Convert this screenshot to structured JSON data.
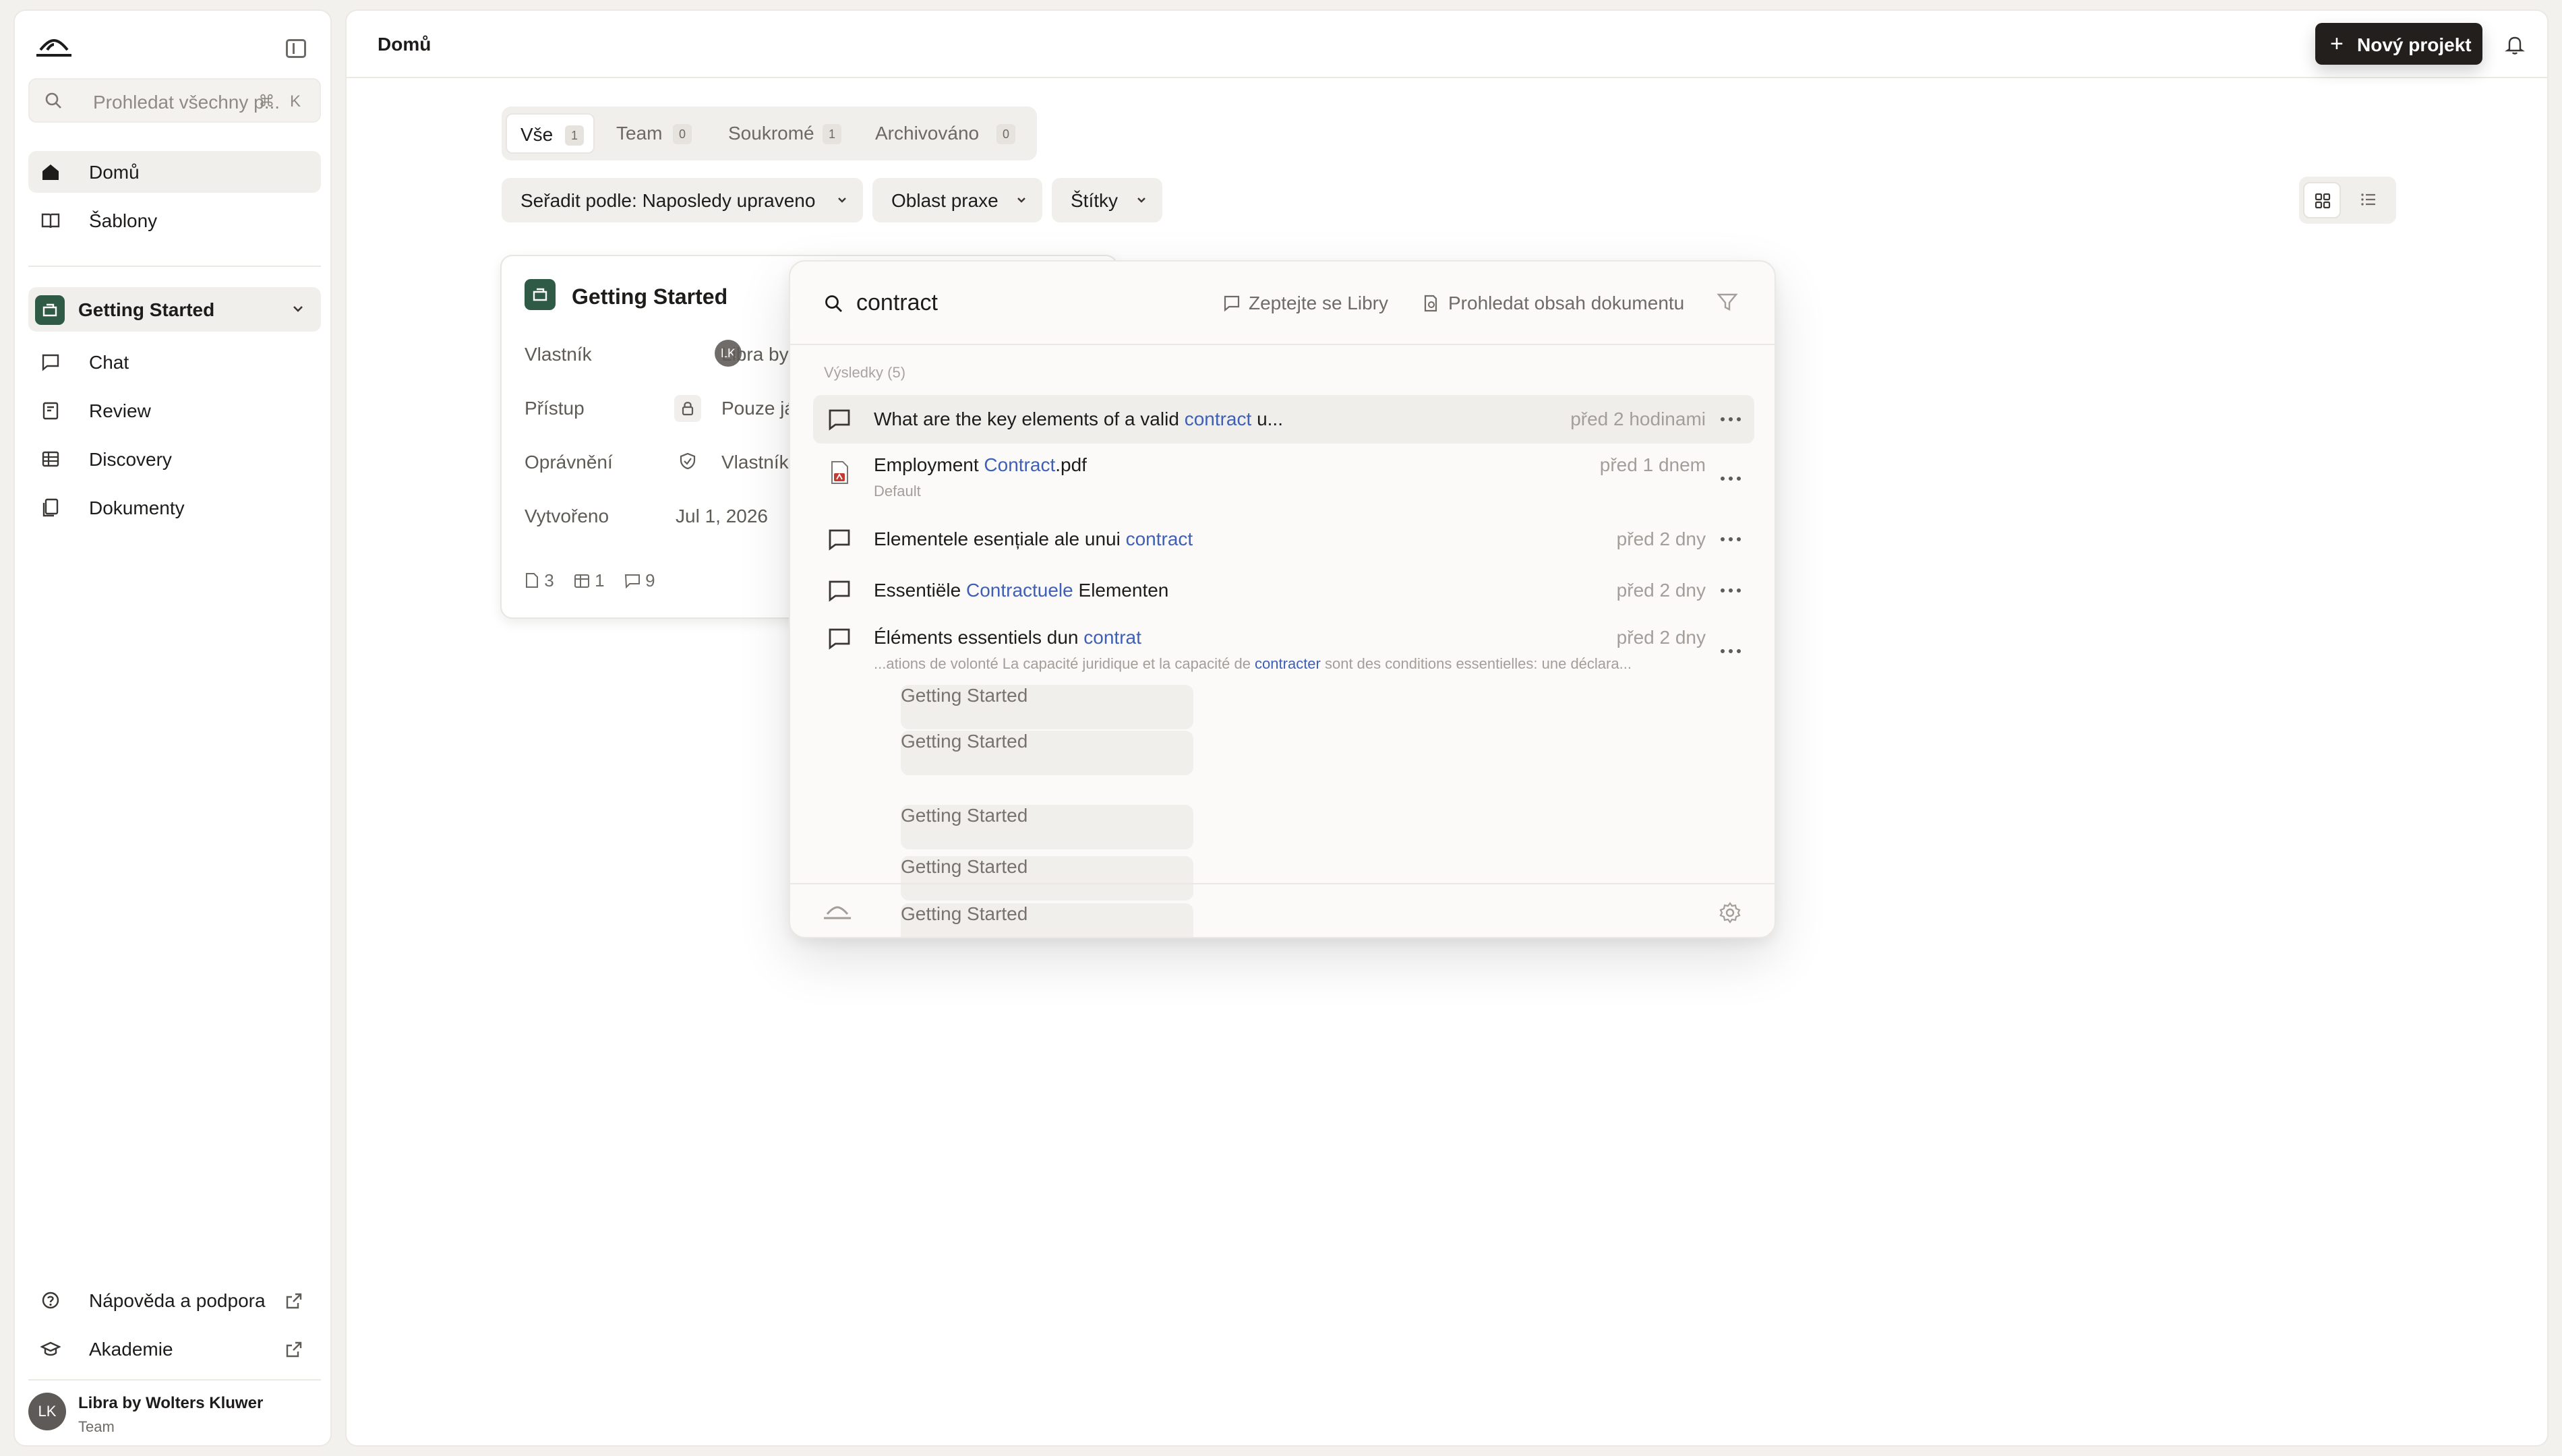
{
  "sidebar": {
    "search_placeholder": "Prohledat všechny p...",
    "search_shortcut": "⌘ K",
    "nav": [
      {
        "label": "Domů",
        "icon": "home-icon"
      },
      {
        "label": "Šablony",
        "icon": "book-icon"
      }
    ],
    "project": {
      "label": "Getting Started"
    },
    "project_nav": [
      {
        "label": "Chat",
        "icon": "chat-icon"
      },
      {
        "label": "Review",
        "icon": "review-icon"
      },
      {
        "label": "Discovery",
        "icon": "table-icon"
      },
      {
        "label": "Dokumenty",
        "icon": "documents-icon"
      }
    ],
    "footer_links": [
      {
        "label": "Nápověda a podpora",
        "icon": "help-icon"
      },
      {
        "label": "Akademie",
        "icon": "academy-icon"
      }
    ],
    "user": {
      "initials": "LK",
      "name": "Libra by Wolters Kluwer",
      "team": "Team"
    }
  },
  "header": {
    "breadcrumb": "Domů",
    "new_project_label": "Nový projekt"
  },
  "tabs": [
    {
      "label": "Vše",
      "count": "1"
    },
    {
      "label": "Team",
      "count": "0"
    },
    {
      "label": "Soukromé",
      "count": "1"
    },
    {
      "label": "Archivováno",
      "count": "0"
    }
  ],
  "filters": {
    "sort_label": "Seřadit podle: Naposledy upraveno",
    "practice_label": "Oblast praxe",
    "tags_label": "Štítky"
  },
  "card": {
    "title": "Getting Started",
    "rows": [
      {
        "key": "Vlastník",
        "value": "Libra by",
        "avatar": "LK"
      },
      {
        "key": "Přístup",
        "value": "Pouze já"
      },
      {
        "key": "Oprávnění",
        "value": "Vlastník"
      },
      {
        "key": "Vytvořeno",
        "value": "Jul 1, 2026"
      }
    ],
    "counts": {
      "docs": "3",
      "tables": "1",
      "chats": "9"
    }
  },
  "palette": {
    "query": "contract",
    "ask_label": "Zeptejte se Libry",
    "search_docs_label": "Prohledat obsah dokumentu",
    "section_label": "Výsledky (5)",
    "results": [
      {
        "pre": "What are the key elements of a valid ",
        "hl": "contract",
        "post": " u...",
        "project": "Getting Started",
        "time": "před 2 hodinami",
        "type": "chat"
      },
      {
        "pre": "Employment ",
        "hl": "Contract",
        "post": ".pdf",
        "project": "Getting Started",
        "sub": "Default",
        "time": "před 1 dnem",
        "type": "pdf"
      },
      {
        "pre": "Elementele esențiale ale unui ",
        "hl": "contract",
        "post": "",
        "project": "Getting Started",
        "time": "před 2 dny",
        "type": "chat"
      },
      {
        "pre": "Essentiële ",
        "hl": "Contractuele",
        "post": " Elementen",
        "project": "Getting Started",
        "time": "před 2 dny",
        "type": "chat"
      },
      {
        "pre": "Éléments essentiels dun ",
        "hl": "contrat",
        "post": "",
        "project": "Getting Started",
        "sub_pre": "...ations de volonté La capacité juridique et la capacité de ",
        "sub_hl": "contracter",
        "sub_post": " sont des conditions essentielles: une déclara...",
        "time": "před 2 dny",
        "type": "chat"
      }
    ]
  }
}
